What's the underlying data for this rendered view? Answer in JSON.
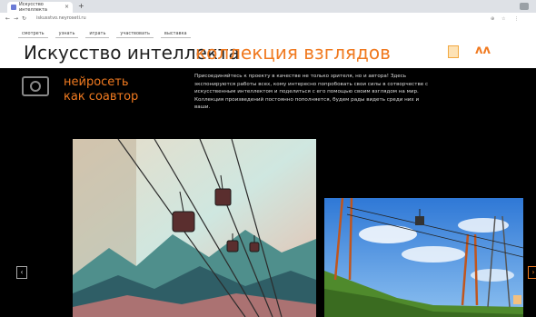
{
  "browser": {
    "tab_title": "Искусство интеллекта",
    "new_tab": "+",
    "url": "iskusstvo.neyroseti.ru"
  },
  "nav": [
    "смотреть",
    "узнать",
    "играть",
    "участвовать",
    "выставка"
  ],
  "header": {
    "title_main": "Искусство интеллекта",
    "title_accent": "коллекция взглядов",
    "logo": "ʌʌ"
  },
  "section": {
    "title_line1": "нейросеть",
    "title_line2": "как соавтор",
    "intro": "Присоединяйтесь к проекту в качестве не только зрителя, но и автора! Здесь экспонируются работы всех, кому интересно попробовать свои силы в сотворчестве с искусственным интеллектом и поделиться с его помощью своим взглядом на мир. Коллекция произведений постоянно пополняется, будем рады видеть среди них и ваши."
  },
  "gallery": {
    "prev": "‹",
    "next": "›"
  },
  "colors": {
    "accent": "#f07a20",
    "background": "#000000",
    "header_bg": "#ffffff"
  }
}
